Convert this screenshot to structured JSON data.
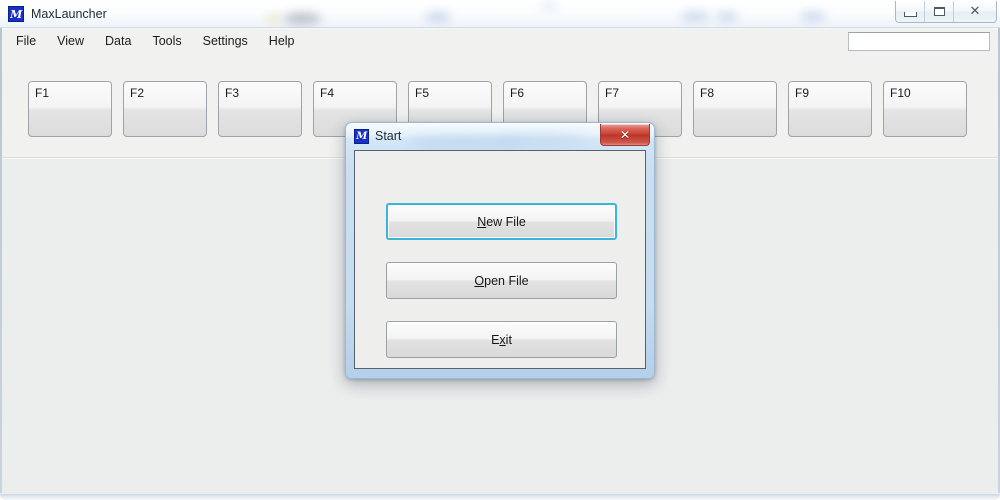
{
  "window": {
    "title": "MaxLauncher",
    "app_icon": "maxlauncher-m-icon",
    "controls": {
      "minimize_label": "–",
      "maximize_label": "□",
      "close_label": "✕"
    }
  },
  "menu": {
    "items": [
      {
        "label": "File"
      },
      {
        "label": "View"
      },
      {
        "label": "Data"
      },
      {
        "label": "Tools"
      },
      {
        "label": "Settings"
      },
      {
        "label": "Help"
      }
    ]
  },
  "search": {
    "value": "",
    "placeholder": ""
  },
  "function_buttons": [
    {
      "label": "F1"
    },
    {
      "label": "F2"
    },
    {
      "label": "F3"
    },
    {
      "label": "F4"
    },
    {
      "label": "F5"
    },
    {
      "label": "F6"
    },
    {
      "label": "F7"
    },
    {
      "label": "F8"
    },
    {
      "label": "F9"
    },
    {
      "label": "F10"
    }
  ],
  "dialog": {
    "title": "Start",
    "icon": "maxlauncher-m-icon",
    "close_label": "✕",
    "buttons": [
      {
        "text_before": "",
        "accel": "N",
        "text_after": "ew File",
        "focused": true
      },
      {
        "text_before": "",
        "accel": "O",
        "text_after": "pen File",
        "focused": false
      },
      {
        "text_before": "E",
        "accel": "x",
        "text_after": "it",
        "focused": false
      }
    ]
  },
  "colors": {
    "accent_focus": "#3ab5da",
    "close_red": "#c73f32",
    "icon_blue": "#1630c8",
    "panel_gray": "#f1f1ef",
    "client_gray": "#eceded"
  }
}
